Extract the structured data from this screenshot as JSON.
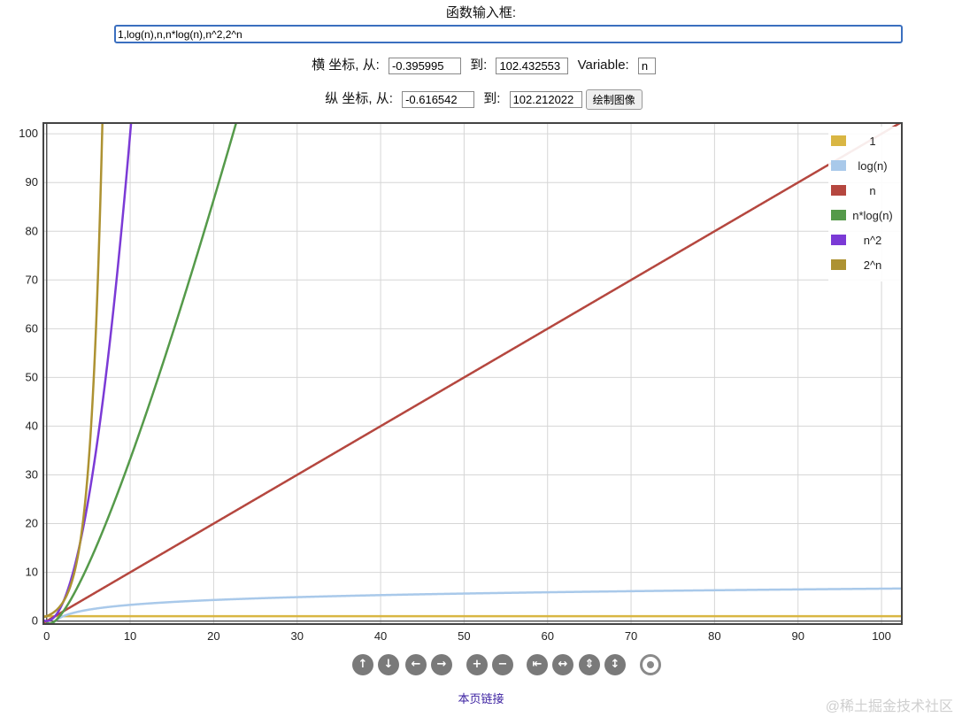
{
  "header": {
    "title": "函数输入框:",
    "function_input": "1,log(n),n,n*log(n),n^2,2^n"
  },
  "x_range": {
    "label": "横 坐标, 从:",
    "from": "-0.395995",
    "to_label": "到:",
    "to": "102.432553",
    "variable_label": "Variable:",
    "variable": "n"
  },
  "y_range": {
    "label": "纵 坐标, 从:",
    "from": "-0.616542",
    "to_label": "到:",
    "to": "102.212022",
    "draw_button": "绘制图像"
  },
  "footer": {
    "link": "本页链接",
    "watermark": "@稀土掘金技术社区"
  },
  "nav_icons": [
    "pan-up-icon",
    "pan-down-icon",
    "pan-left-icon",
    "pan-right-icon",
    "zoom-in-icon",
    "zoom-out-icon",
    "zoom-x-in-icon",
    "zoom-x-out-icon",
    "zoom-y-in-icon",
    "zoom-y-out-icon",
    "reset-view-icon"
  ],
  "chart_data": {
    "type": "line",
    "xlim": [
      -0.395995,
      102.432553
    ],
    "ylim": [
      -0.616542,
      102.212022
    ],
    "x_ticks": [
      0,
      10,
      20,
      30,
      40,
      50,
      60,
      70,
      80,
      90,
      100
    ],
    "y_ticks": [
      0,
      10,
      20,
      30,
      40,
      50,
      60,
      70,
      80,
      90,
      100
    ],
    "grid": true,
    "legend_position": "top-right",
    "series": [
      {
        "name": "1",
        "expr": "1",
        "color": "#d9b643"
      },
      {
        "name": "log(n)",
        "expr": "log(n)",
        "color": "#a9c9ea"
      },
      {
        "name": "n",
        "expr": "n",
        "color": "#b5473f"
      },
      {
        "name": "n*log(n)",
        "expr": "n*log(n)",
        "color": "#559a4a"
      },
      {
        "name": "n^2",
        "expr": "n^2",
        "color": "#7b3ad6"
      },
      {
        "name": "2^n",
        "expr": "2^n",
        "color": "#ad9232"
      }
    ]
  }
}
